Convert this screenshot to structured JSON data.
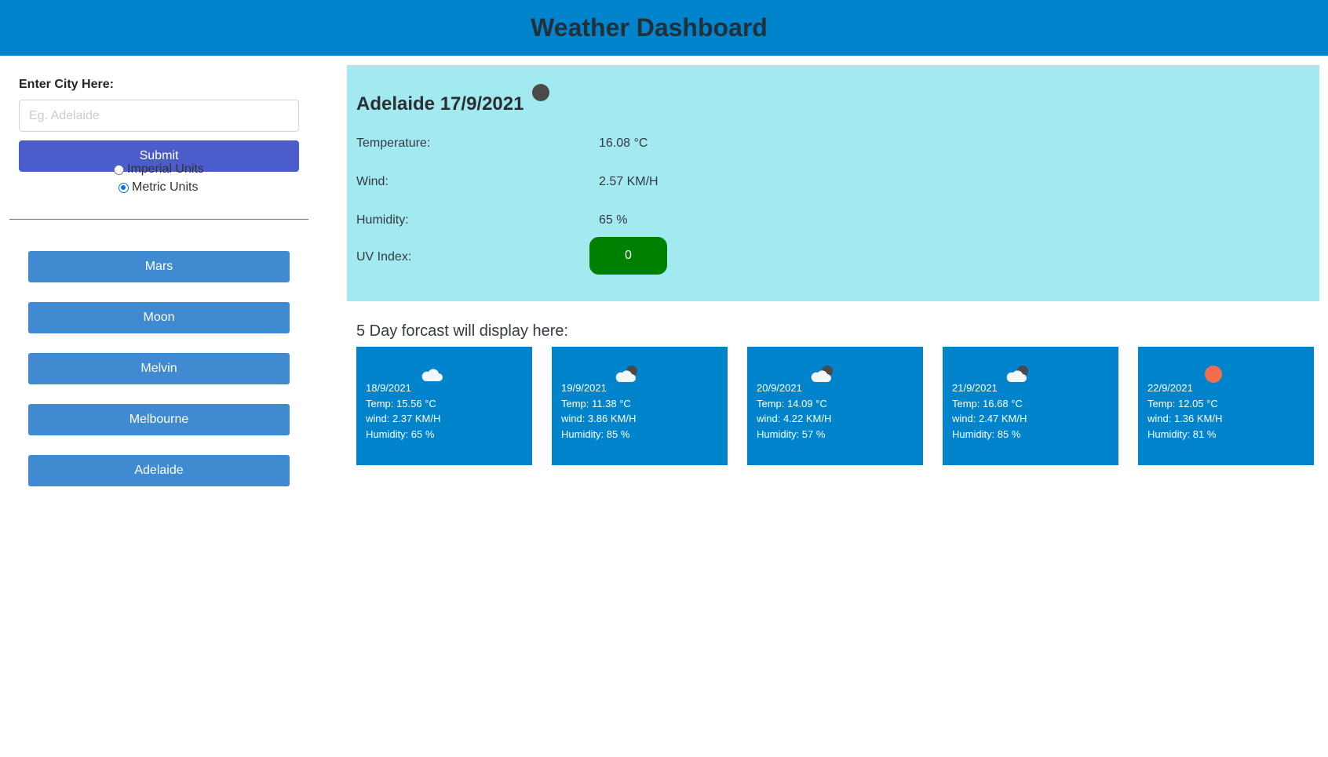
{
  "header": {
    "title": "Weather Dashboard"
  },
  "search": {
    "label": "Enter City Here:",
    "placeholder": "Eg. Adelaide",
    "value": "",
    "submit_label": "Submit"
  },
  "units": {
    "options": [
      {
        "label": "Imperial Units",
        "checked": false
      },
      {
        "label": "Metric Units",
        "checked": true
      }
    ]
  },
  "history": [
    "Mars",
    "Moon",
    "Melvin",
    "Melbourne",
    "Adelaide"
  ],
  "current": {
    "title": "Adelaide 17/9/2021",
    "icon": "night-clear-icon",
    "rows": [
      {
        "label": "Temperature:",
        "value": "16.08 °C"
      },
      {
        "label": "Wind:",
        "value": "2.57 KM/H"
      },
      {
        "label": "Humidity:",
        "value": "65 %"
      },
      {
        "label": "UV Index:",
        "value": "0"
      }
    ],
    "uv_color": "#008000"
  },
  "forecast": {
    "title": "5 Day forcast will display here:",
    "days": [
      {
        "date": "18/9/2021",
        "temp": "Temp: 15.56 °C",
        "wind": "wind: 2.37 KM/H",
        "humidity": "Humidity: 65 %",
        "icon": "cloud-icon"
      },
      {
        "date": "19/9/2021",
        "temp": "Temp: 11.38 °C",
        "wind": "wind: 3.86 KM/H",
        "humidity": "Humidity: 85 %",
        "icon": "cloud-night-icon"
      },
      {
        "date": "20/9/2021",
        "temp": "Temp: 14.09 °C",
        "wind": "wind: 4.22 KM/H",
        "humidity": "Humidity: 57 %",
        "icon": "cloud-night-icon"
      },
      {
        "date": "21/9/2021",
        "temp": "Temp: 16.68 °C",
        "wind": "wind: 2.47 KM/H",
        "humidity": "Humidity: 85 %",
        "icon": "cloud-night-icon"
      },
      {
        "date": "22/9/2021",
        "temp": "Temp: 12.05 °C",
        "wind": "wind: 1.36 KM/H",
        "humidity": "Humidity: 81 %",
        "icon": "sun-icon"
      }
    ]
  },
  "colors": {
    "header_bg": "#0184cb",
    "submit_bg": "#4a5dca",
    "history_bg": "#3f8ad0",
    "current_bg": "#a2eaf0",
    "card_bg": "#0184cb",
    "sun": "#f26d4b"
  }
}
